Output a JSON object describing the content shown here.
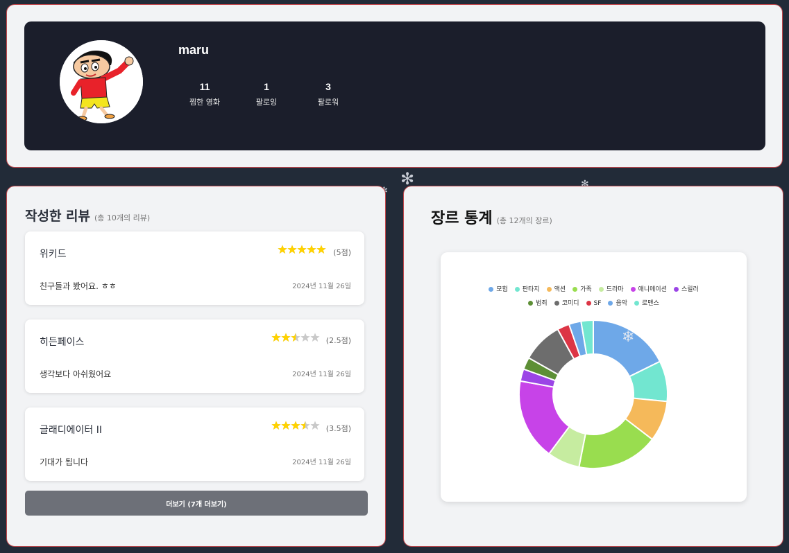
{
  "profile": {
    "username": "maru",
    "stats": [
      {
        "value": "11",
        "label": "찜한 영화"
      },
      {
        "value": "1",
        "label": "팔로잉"
      },
      {
        "value": "3",
        "label": "팔로워"
      }
    ]
  },
  "reviews": {
    "title": "작성한 리뷰",
    "subtitle": "(총 10개의 리뷰)",
    "items": [
      {
        "title": "위키드",
        "rating": 5,
        "score_text": "(5점)",
        "text": "친구들과 봤어요. ㅎㅎ",
        "date": "2024년 11월 26일"
      },
      {
        "title": "히든페이스",
        "rating": 2.5,
        "score_text": "(2.5점)",
        "text": "생각보다 아쉬웠어요",
        "date": "2024년 11월 26일"
      },
      {
        "title": "글래디에이터 II",
        "rating": 3.5,
        "score_text": "(3.5점)",
        "text": "기대가 됩니다",
        "date": "2024년 11월 26일"
      }
    ],
    "more_label": "더보기 (7개 더보기)"
  },
  "genres": {
    "title": "장르 통계",
    "subtitle": "(총 12개의 장르)"
  },
  "chart_data": {
    "type": "pie",
    "variant": "doughnut",
    "legend_position": "top",
    "series": [
      {
        "name": "모험",
        "value": 2,
        "color": "#6ea8e8"
      },
      {
        "name": "판타지",
        "value": 1,
        "color": "#72e6d0"
      },
      {
        "name": "액션",
        "value": 1,
        "color": "#f5b95a"
      },
      {
        "name": "가족",
        "value": 2,
        "color": "#99dd4f"
      },
      {
        "name": "드라마",
        "value": 0.8,
        "color": "#c6eca0"
      },
      {
        "name": "애니메이션",
        "value": 2,
        "color": "#c743e8"
      },
      {
        "name": "스릴러",
        "value": 0.3,
        "color": "#9b45e6"
      },
      {
        "name": "범죄",
        "value": 0.3,
        "color": "#5d8f36"
      },
      {
        "name": "코미디",
        "value": 1,
        "color": "#6d6d6d"
      },
      {
        "name": "SF",
        "value": 0.3,
        "color": "#dc3545"
      },
      {
        "name": "음악",
        "value": 0.3,
        "color": "#6ea8e8"
      },
      {
        "name": "로맨스",
        "value": 0.3,
        "color": "#72e6d0"
      }
    ]
  },
  "colors": {
    "background": "#222b38",
    "panel": "#f2f3f5",
    "panel_border": "#c0474c",
    "profile_card": "#1b1e2b",
    "star_filled": "#ffd200",
    "star_empty": "#c9c9c9",
    "button": "#6d7078"
  },
  "icons": [
    "avatar-cartoon",
    "star-icon",
    "snowflake-icon"
  ]
}
